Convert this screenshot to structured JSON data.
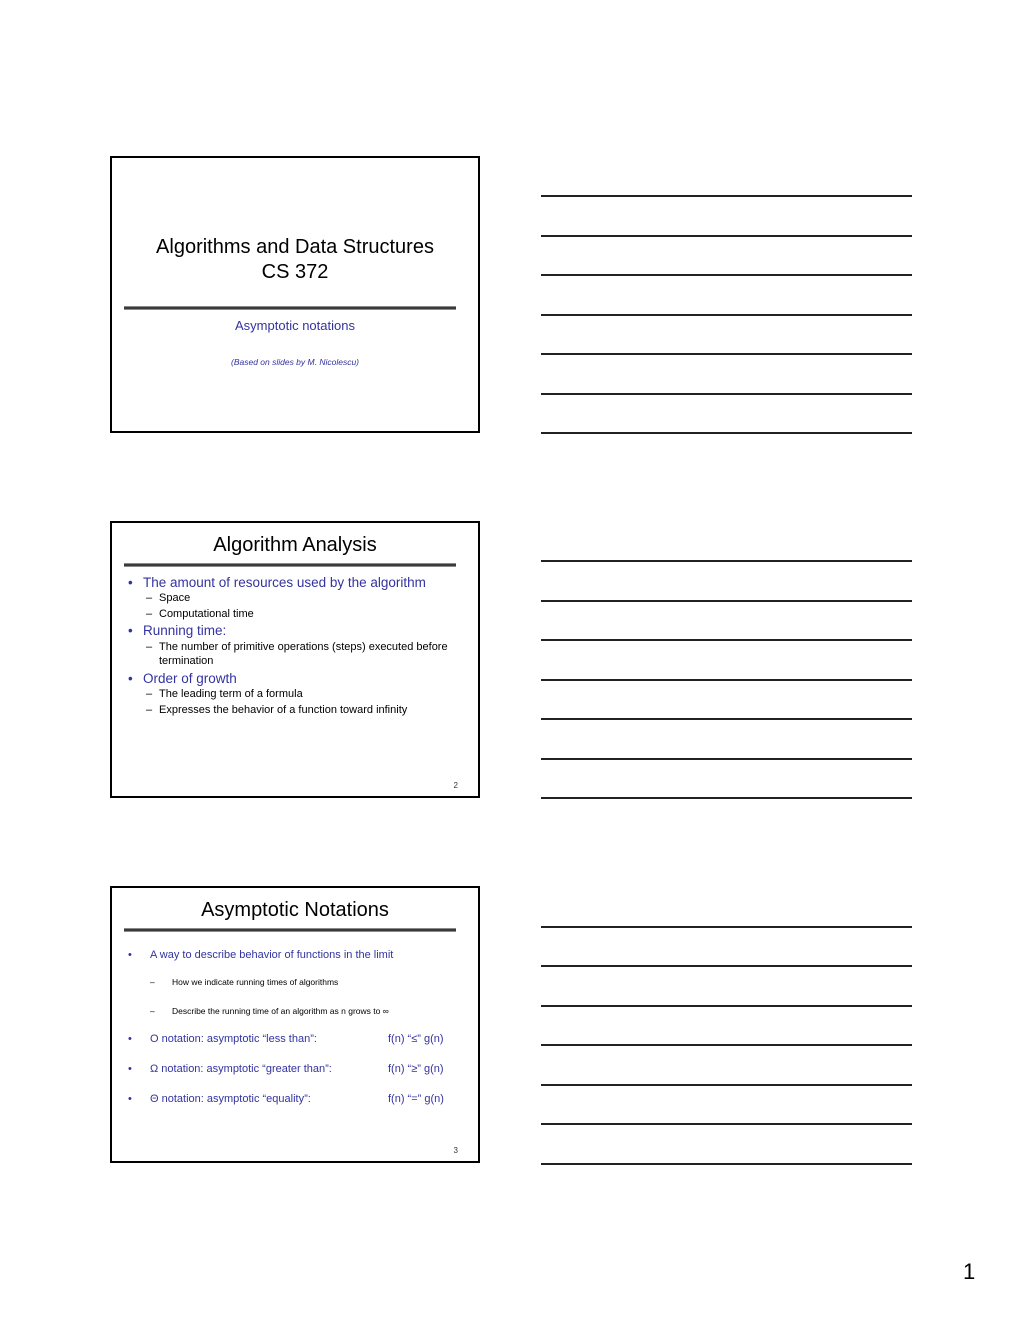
{
  "slides": [
    {
      "title_line1": "Algorithms and Data Structures",
      "title_line2": "CS 372",
      "subtitle": "Asymptotic notations",
      "credit": "(Based on slides by M. Nicolescu)"
    },
    {
      "title": "Algorithm Analysis",
      "bullets": [
        {
          "text": "The amount of resources used by the algorithm",
          "subs": [
            "Space",
            "Computational time"
          ]
        },
        {
          "text": "Running time:",
          "subs": [
            "The number of primitive operations (steps) executed before termination"
          ]
        },
        {
          "text": "Order of growth",
          "subs": [
            "The leading term of a formula",
            "Expresses the behavior of a function toward infinity"
          ]
        }
      ],
      "page_number": "2"
    },
    {
      "title": "Asymptotic Notations",
      "intro": "A way to describe behavior of functions in the limit",
      "intro_subs": [
        "How we indicate running times of algorithms",
        "Describe the running time of an algorithm as n grows to ∞"
      ],
      "notations": [
        {
          "text": "O notation: asymptotic “less than”:",
          "relation": "f(n) “≤” g(n)"
        },
        {
          "text": "Ω notation: asymptotic “greater than”:",
          "relation": "f(n) “≥” g(n)"
        },
        {
          "text": "Θ notation: asymptotic “equality”:",
          "relation": "f(n) “=” g(n)"
        }
      ],
      "page_number": "3"
    }
  ],
  "bullet_glyph": "•",
  "dash_glyph": "–",
  "page_number": "1"
}
